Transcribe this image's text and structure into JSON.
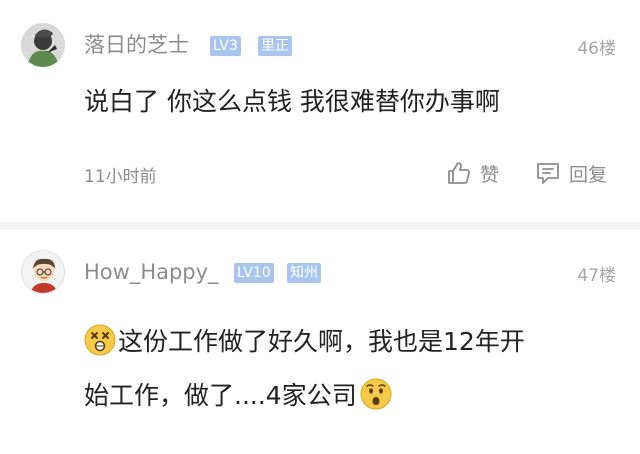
{
  "comments": [
    {
      "username": "落日的芝士",
      "level": "LV3",
      "location": "里正",
      "floor": "46楼",
      "text": "说白了 你这么点钱 我很难替你办事啊",
      "time": "11小时前",
      "actions": {
        "like_label": "赞",
        "reply_label": "回复"
      }
    },
    {
      "username": "How_Happy_",
      "level": "LV10",
      "location": "知州",
      "floor": "47楼",
      "line1": "这份工作做了好久啊，我也是12年开",
      "line2": "始工作，做了....4家公司",
      "emoji_start": "dizzy-face",
      "emoji_end": "anguished-face"
    }
  ],
  "colors": {
    "username": "#8c8c8c",
    "badge_bg": "#a9c5ee",
    "content": "#222222",
    "meta": "#a6a6a6",
    "divider": "#f4f4f6"
  },
  "icons": {
    "like": "thumbs-up-icon",
    "reply": "speech-bubble-icon"
  }
}
